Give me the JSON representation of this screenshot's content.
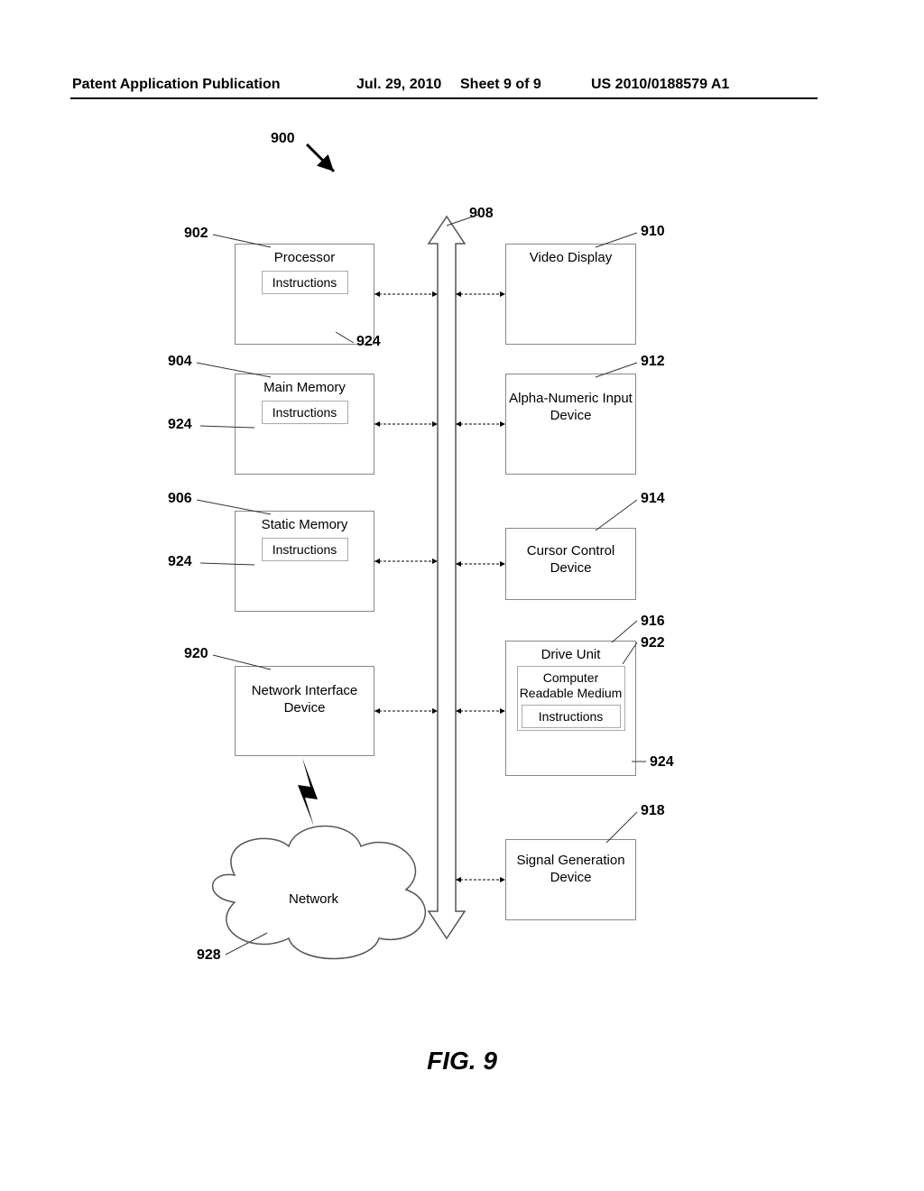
{
  "header": {
    "publication_label": "Patent Application Publication",
    "date": "Jul. 29, 2010",
    "sheet": "Sheet 9 of 9",
    "docno": "US 2010/0188579 A1"
  },
  "diagram": {
    "system_ref": "900",
    "left": [
      {
        "ref": "902",
        "label": "Processor",
        "sub": "Instructions",
        "sub_ref": "924"
      },
      {
        "ref": "904",
        "label": "Main Memory",
        "sub": "Instructions",
        "sub_ref": "924"
      },
      {
        "ref": "906",
        "label": "Static Memory",
        "sub": "Instructions",
        "sub_ref": "924"
      },
      {
        "ref": "920",
        "label": "Network Interface Device"
      }
    ],
    "right": [
      {
        "ref": "910",
        "label": "Video Display"
      },
      {
        "ref": "912",
        "label": "Alpha-Numeric Input Device"
      },
      {
        "ref": "914",
        "label": "Cursor Control Device"
      },
      {
        "ref": "916",
        "label": "Drive Unit",
        "sub_label": "Computer Readable Medium",
        "sub": "Instructions",
        "sub_ref": "924",
        "medium_ref": "922"
      },
      {
        "ref": "918",
        "label": "Signal Generation Device"
      }
    ],
    "bus_ref": "908",
    "network_ref": "928",
    "network_label": "Network"
  },
  "figure_caption": "FIG. 9"
}
